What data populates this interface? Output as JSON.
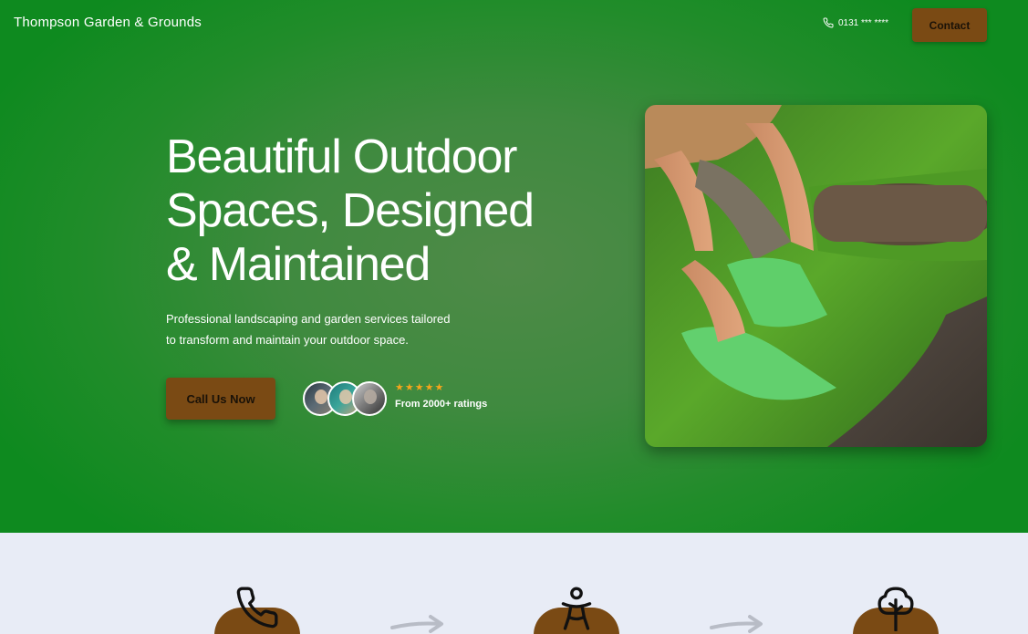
{
  "header": {
    "brand": "Thompson Garden & Grounds",
    "phone_icon": "phone-icon",
    "phone_number": "0131 *** ****",
    "contact_label": "Contact"
  },
  "hero": {
    "headline_line1": "Beautiful Outdoor",
    "headline_line2": "Spaces, Designed",
    "headline_line3": "& Maintained",
    "subtext_line1": "Professional landscaping and garden services tailored",
    "subtext_line2": "to transform and maintain your outdoor space.",
    "cta_label": "Call Us Now",
    "stars": "★★★★★",
    "ratings_text": "From 2000+ ratings",
    "rating_value": 5,
    "avatars": [
      "customer-avatar",
      "customer-avatar",
      "customer-avatar"
    ],
    "photo": "gardener-laying-turf-photo"
  },
  "steps": {
    "icons": [
      "phone-icon",
      "person-icon",
      "tree-icon"
    ],
    "arrows": [
      "arrow-right-icon",
      "arrow-right-icon"
    ]
  },
  "colors": {
    "hero_green": "#218c2a",
    "accent_brown": "#7a4a14",
    "star_orange": "#f4a51c",
    "section_bg": "#e8ecf6"
  }
}
